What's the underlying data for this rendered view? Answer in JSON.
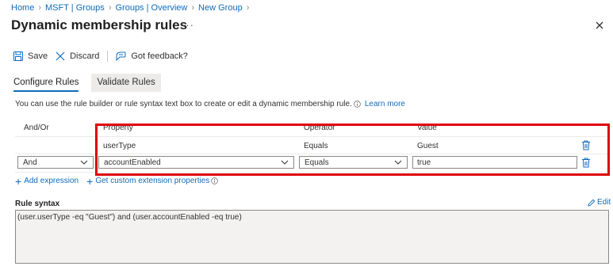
{
  "breadcrumb": [
    "Home",
    "MSFT | Groups",
    "Groups | Overview",
    "New Group"
  ],
  "page": {
    "title": "Dynamic membership rules",
    "more": "···"
  },
  "toolbar": {
    "save": "Save",
    "discard": "Discard",
    "feedback": "Got feedback?"
  },
  "tabs": [
    "Configure Rules",
    "Validate Rules"
  ],
  "description": {
    "text": "You can use the rule builder or rule syntax text box to create or edit a dynamic membership rule.",
    "link": "Learn more"
  },
  "table": {
    "headers": {
      "andor": "And/Or",
      "property": "Property",
      "operator": "Operator",
      "value": "Value"
    },
    "rows": [
      {
        "andor": "",
        "property": "userType",
        "operator": "Equals",
        "value": "Guest"
      },
      {
        "andor": "And",
        "property": "accountEnabled",
        "operator": "Equals",
        "value": "true"
      }
    ]
  },
  "actions": {
    "add_expression": "Add expression",
    "custom_ext": "Get custom extension properties"
  },
  "syntax": {
    "label": "Rule syntax",
    "edit": "Edit",
    "value": "(user.userType -eq \"Guest\") and (user.accountEnabled -eq true)"
  },
  "colors": {
    "accent": "#0f6cbd",
    "highlight": "#e00000"
  }
}
